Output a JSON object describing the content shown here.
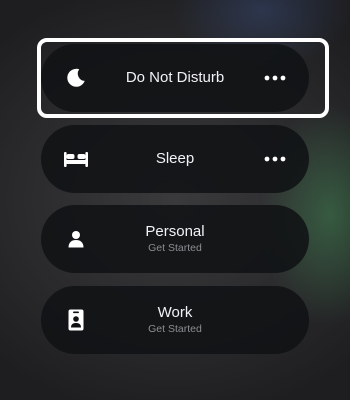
{
  "focus_modes": [
    {
      "name": "Do Not Disturb",
      "subtitle": "",
      "icon": "moon-icon",
      "selected": true,
      "has_more": true
    },
    {
      "name": "Sleep",
      "subtitle": "",
      "icon": "bed-icon",
      "selected": false,
      "has_more": true
    },
    {
      "name": "Personal",
      "subtitle": "Get Started",
      "icon": "person-icon",
      "selected": false,
      "has_more": false
    },
    {
      "name": "Work",
      "subtitle": "Get Started",
      "icon": "id-badge-icon",
      "selected": false,
      "has_more": false
    }
  ],
  "colors": {
    "card_background": "#101214",
    "title_text": "#f2f2f7",
    "subtitle_text": "#8d8d92",
    "selection_outline": "#ffffff"
  }
}
